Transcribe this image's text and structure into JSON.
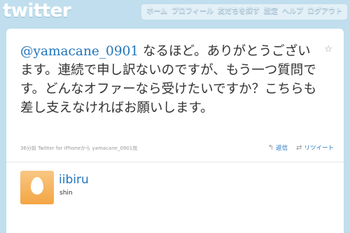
{
  "header": {
    "logo_text": "twitter",
    "nav": [
      "ホーム",
      "プロフィール",
      "友だちを探す",
      "設定",
      "ヘルプ",
      "ログアウト"
    ]
  },
  "tweet": {
    "mention": "@yamacane_0901",
    "body": " なるほど。ありがとうございます。連続で申し訳ないのですが、もう一つ質問です。どんなオファーなら受けたいですか？こちらも差し支えなければお願いします。",
    "meta": "36分前 Twitter for iPhoneから yamacane_0901宛",
    "reply_label": "返信",
    "retweet_label": "リツイート",
    "favorite_icon": "☆"
  },
  "author": {
    "screen_name": "iibiru",
    "name": "shin"
  },
  "colors": {
    "background": "#c0deed",
    "link": "#2276bb",
    "avatar": "#f3a543"
  }
}
